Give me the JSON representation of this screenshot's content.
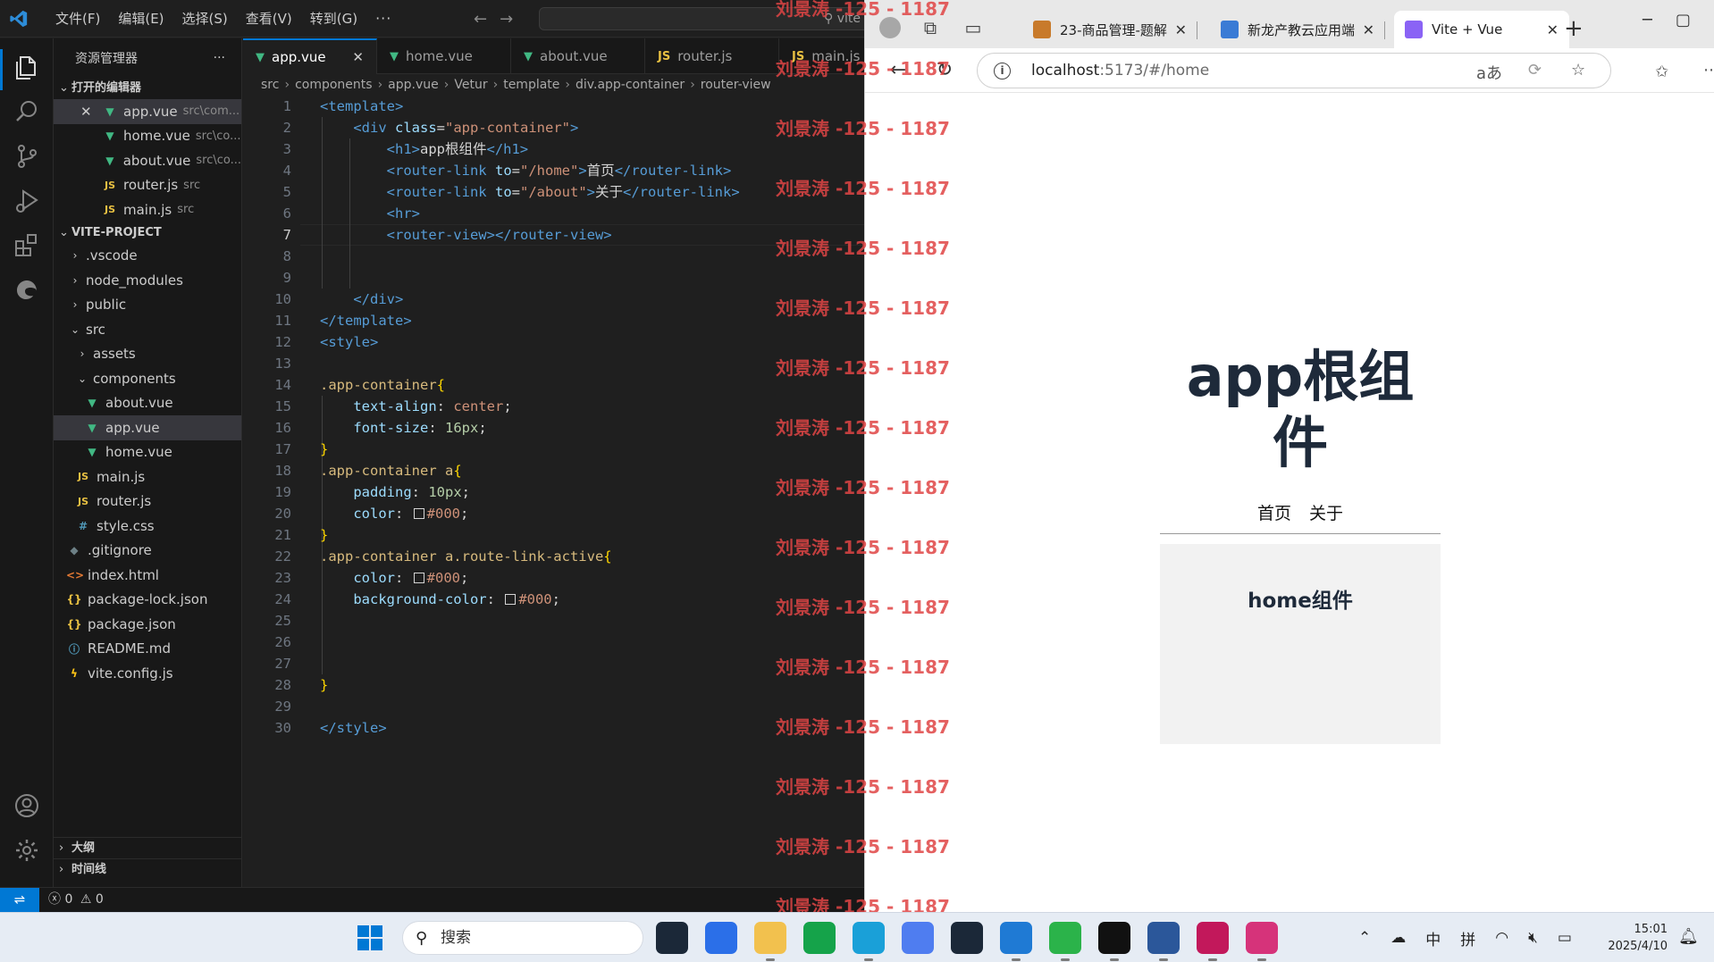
{
  "vscode": {
    "menu": [
      "文件(F)",
      "编辑(E)",
      "选择(S)",
      "查看(V)",
      "转到(G)",
      "···"
    ],
    "command_center": "vite",
    "explorer_title": "资源管理器",
    "explorer_more": "···",
    "open_editors_header": "打开的编辑器",
    "open_editors": [
      {
        "name": "app.vue",
        "desc": "src\\com...",
        "icon": "vue-icon",
        "selected": true
      },
      {
        "name": "home.vue",
        "desc": "src\\co...",
        "icon": "vue-icon"
      },
      {
        "name": "about.vue",
        "desc": "src\\co...",
        "icon": "vue-icon"
      },
      {
        "name": "router.js",
        "desc": "src",
        "icon": "js-icon"
      },
      {
        "name": "main.js",
        "desc": "src",
        "icon": "js-icon"
      }
    ],
    "project_header": "VITE-PROJECT",
    "tree": [
      {
        "name": ".vscode",
        "type": "folder",
        "indent": 1,
        "open": false
      },
      {
        "name": "node_modules",
        "type": "folder",
        "indent": 1,
        "open": false
      },
      {
        "name": "public",
        "type": "folder",
        "indent": 1,
        "open": false
      },
      {
        "name": "src",
        "type": "folder",
        "indent": 1,
        "open": true
      },
      {
        "name": "assets",
        "type": "folder",
        "indent": 2,
        "open": false
      },
      {
        "name": "components",
        "type": "folder",
        "indent": 2,
        "open": true
      },
      {
        "name": "about.vue",
        "type": "vue",
        "indent": 3
      },
      {
        "name": "app.vue",
        "type": "vue",
        "indent": 3,
        "selected": true
      },
      {
        "name": "home.vue",
        "type": "vue",
        "indent": 3
      },
      {
        "name": "main.js",
        "type": "js",
        "indent": 2
      },
      {
        "name": "router.js",
        "type": "js",
        "indent": 2
      },
      {
        "name": "style.css",
        "type": "css",
        "indent": 2
      },
      {
        "name": ".gitignore",
        "type": "git",
        "indent": 1
      },
      {
        "name": "index.html",
        "type": "html",
        "indent": 1
      },
      {
        "name": "package-lock.json",
        "type": "json",
        "indent": 1
      },
      {
        "name": "package.json",
        "type": "json",
        "indent": 1
      },
      {
        "name": "README.md",
        "type": "info",
        "indent": 1
      },
      {
        "name": "vite.config.js",
        "type": "vite",
        "indent": 1
      }
    ],
    "outline_header": "大纲",
    "timeline_header": "时间线",
    "tabs": [
      {
        "name": "app.vue",
        "icon": "vue-icon",
        "active": true
      },
      {
        "name": "home.vue",
        "icon": "vue-icon"
      },
      {
        "name": "about.vue",
        "icon": "vue-icon"
      },
      {
        "name": "router.js",
        "icon": "js-icon"
      },
      {
        "name": "main.js",
        "icon": "js-icon"
      }
    ],
    "breadcrumb": [
      "src",
      "components",
      "app.vue",
      "Vetur",
      "template",
      "div.app-container",
      "router-view"
    ],
    "current_line": 7,
    "code": [
      [
        [
          "t-tag",
          "<template>"
        ]
      ],
      [
        [
          "t-txt",
          "    "
        ],
        [
          "t-tag",
          "<div "
        ],
        [
          "t-attr",
          "class"
        ],
        [
          "t-punc",
          "="
        ],
        [
          "t-str",
          "\"app-container\""
        ],
        [
          "t-tag",
          ">"
        ]
      ],
      [
        [
          "t-txt",
          "        "
        ],
        [
          "t-tag",
          "<h1>"
        ],
        [
          "t-txt",
          "app根组件"
        ],
        [
          "t-tag",
          "</h1>"
        ]
      ],
      [
        [
          "t-txt",
          "        "
        ],
        [
          "t-tag",
          "<router-link "
        ],
        [
          "t-attr",
          "to"
        ],
        [
          "t-punc",
          "="
        ],
        [
          "t-str",
          "\"/home\""
        ],
        [
          "t-tag",
          ">"
        ],
        [
          "t-txt",
          "首页"
        ],
        [
          "t-tag",
          "</router-link>"
        ]
      ],
      [
        [
          "t-txt",
          "        "
        ],
        [
          "t-tag",
          "<router-link "
        ],
        [
          "t-attr",
          "to"
        ],
        [
          "t-punc",
          "="
        ],
        [
          "t-str",
          "\"/about\""
        ],
        [
          "t-tag",
          ">"
        ],
        [
          "t-txt",
          "关于"
        ],
        [
          "t-tag",
          "</router-link>"
        ]
      ],
      [
        [
          "t-txt",
          "        "
        ],
        [
          "t-tag",
          "<hr>"
        ]
      ],
      [
        [
          "t-txt",
          "        "
        ],
        [
          "t-tag",
          "<router-view></router-view>"
        ]
      ],
      [],
      [],
      [
        [
          "t-txt",
          "    "
        ],
        [
          "t-tag",
          "</div>"
        ]
      ],
      [
        [
          "t-tag",
          "</template>"
        ]
      ],
      [
        [
          "t-tag",
          "<style>"
        ]
      ],
      [],
      [
        [
          "t-sel",
          ".app-container"
        ],
        [
          "t-brace",
          "{"
        ]
      ],
      [
        [
          "t-txt",
          "    "
        ],
        [
          "t-prop",
          "text-align"
        ],
        [
          "t-punc",
          ": "
        ],
        [
          "t-val",
          "center"
        ],
        [
          "t-punc",
          ";"
        ]
      ],
      [
        [
          "t-txt",
          "    "
        ],
        [
          "t-prop",
          "font-size"
        ],
        [
          "t-punc",
          ": "
        ],
        [
          "t-num",
          "16px"
        ],
        [
          "t-punc",
          ";"
        ]
      ],
      [
        [
          "t-brace",
          "}"
        ]
      ],
      [
        [
          "t-sel",
          ".app-container a"
        ],
        [
          "t-brace",
          "{"
        ]
      ],
      [
        [
          "t-txt",
          "    "
        ],
        [
          "t-prop",
          "padding"
        ],
        [
          "t-punc",
          ": "
        ],
        [
          "t-num",
          "10px"
        ],
        [
          "t-punc",
          ";"
        ]
      ],
      [
        [
          "t-txt",
          "    "
        ],
        [
          "t-prop",
          "color"
        ],
        [
          "t-punc",
          ": "
        ],
        [
          "swatch",
          ""
        ],
        [
          "t-val",
          "#000"
        ],
        [
          "t-punc",
          ";"
        ]
      ],
      [
        [
          "t-brace",
          "}"
        ]
      ],
      [
        [
          "t-sel",
          ".app-container a.route-link-active"
        ],
        [
          "t-brace",
          "{"
        ]
      ],
      [
        [
          "t-txt",
          "    "
        ],
        [
          "t-prop",
          "color"
        ],
        [
          "t-punc",
          ": "
        ],
        [
          "swatch",
          ""
        ],
        [
          "t-val",
          "#000"
        ],
        [
          "t-punc",
          ";"
        ]
      ],
      [
        [
          "t-txt",
          "    "
        ],
        [
          "t-prop",
          "background-color"
        ],
        [
          "t-punc",
          ": "
        ],
        [
          "swatch",
          ""
        ],
        [
          "t-val",
          "#000"
        ],
        [
          "t-punc",
          ";"
        ]
      ],
      [],
      [],
      [],
      [
        [
          "t-brace",
          "}"
        ]
      ],
      [],
      [
        [
          "t-tag",
          "</style>"
        ]
      ]
    ],
    "status": {
      "errors": "0",
      "warnings": "0"
    }
  },
  "browser": {
    "tabs": [
      {
        "title": "23-商品管理-题解",
        "favicon_color": "#c87a2b"
      },
      {
        "title": "新龙产教云应用端",
        "favicon_color": "#3a7bd5"
      },
      {
        "title": "Vite + Vue",
        "favicon_color": "#8a63f5",
        "active": true
      }
    ],
    "url_host": "localhost",
    "url_rest": ":5173/#/home",
    "app": {
      "title": "app根组件",
      "links": [
        "首页",
        "关于"
      ],
      "view_title": "home组件"
    }
  },
  "watermark": "刘景涛 -125 - 1187",
  "taskbar": {
    "search_label": "搜索",
    "tray": [
      "中",
      "拼"
    ],
    "time": "15:01",
    "date": "2025/4/10",
    "apps": [
      {
        "name": "steam-icon",
        "color": "#1b2838"
      },
      {
        "name": "feishu-icon",
        "color": "#2b6fe8"
      },
      {
        "name": "file-explorer-icon",
        "color": "#f2c14e",
        "running": true
      },
      {
        "name": "store-icon",
        "color": "#15a34a"
      },
      {
        "name": "edge-icon",
        "color": "#1aa0d8",
        "running": true
      },
      {
        "name": "notes-icon",
        "color": "#4f7df0"
      },
      {
        "name": "steam-icon-2",
        "color": "#1b2838"
      },
      {
        "name": "vscode-icon",
        "color": "#1f7ad4",
        "running": true
      },
      {
        "name": "wechat-icon",
        "color": "#2bb34a",
        "running": true
      },
      {
        "name": "qq-icon",
        "color": "#111111",
        "running": true
      },
      {
        "name": "word-icon",
        "color": "#2b579a",
        "running": true
      },
      {
        "name": "intellij-icon",
        "color": "#c2185b",
        "running": true
      },
      {
        "name": "snipping-icon",
        "color": "#d6337a",
        "running": true
      }
    ]
  }
}
